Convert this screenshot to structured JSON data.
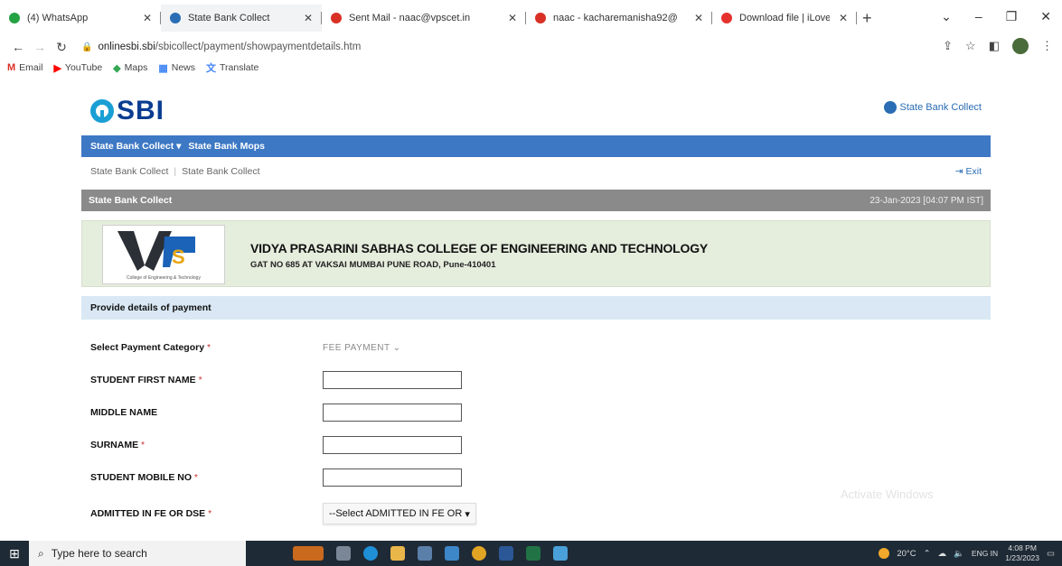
{
  "browser": {
    "tabs": [
      {
        "label": "(4) WhatsApp",
        "favicon": "whatsapp-icon",
        "color": "#25a244"
      },
      {
        "label": "State Bank Collect",
        "favicon": "sbi-icon",
        "color": "#2a6db5"
      },
      {
        "label": "Sent Mail - naac@vpscet.in",
        "favicon": "gmail-icon",
        "color": "#d93025"
      },
      {
        "label": "naac - kacharemanisha92@",
        "favicon": "gmail-icon",
        "color": "#d93025"
      },
      {
        "label": "Download file | iLovePDF",
        "favicon": "ilovepdf-icon",
        "color": "#e5322d"
      }
    ],
    "url_host": "onlinesbi.sbi",
    "url_path": "/sbicollect/payment/showpaymentdetails.htm",
    "bookmarks": [
      {
        "label": "Email",
        "icon": "gmail-icon",
        "color": "#d93025"
      },
      {
        "label": "YouTube",
        "icon": "youtube-icon",
        "color": "#ff0000"
      },
      {
        "label": "Maps",
        "icon": "maps-icon",
        "color": "#34a853"
      },
      {
        "label": "News",
        "icon": "news-icon",
        "color": "#4285f4"
      },
      {
        "label": "Translate",
        "icon": "translate-icon",
        "color": "#4285f4"
      }
    ]
  },
  "sbi": {
    "logo_text": "SBI",
    "collect_link": "State Bank Collect",
    "menu": [
      "State Bank Collect",
      "State Bank Mops"
    ],
    "breadcrumb": [
      "State Bank Collect",
      "State Bank Collect"
    ],
    "exit_label": "Exit",
    "section_title": "State Bank Collect",
    "datetime": "23-Jan-2023 [04:07 PM IST]",
    "college_name": "VIDYA PRASARINI SABHAS COLLEGE OF ENGINEERING AND TECHNOLOGY",
    "college_address": "GAT NO 685 AT VAKSAI MUMBAI PUNE ROAD,  Pune-410401",
    "college_logo_caption": "College of Engineering & Technology",
    "provide_title": "Provide details of payment",
    "form": {
      "category_label": "Select Payment Category",
      "category_value": "FEE PAYMENT",
      "first_name_label": "STUDENT FIRST NAME",
      "middle_name_label": "MIDDLE NAME",
      "surname_label": "SURNAME",
      "mobile_label": "STUDENT MOBILE NO",
      "admitted_label": "ADMITTED IN FE OR DSE",
      "admitted_value": "--Select ADMITTED IN FE OR",
      "required_mark": "*"
    },
    "watermark": "Activate Windows"
  },
  "taskbar": {
    "search_placeholder": "Type here to search",
    "weather": "20°C",
    "lang": "ENG IN",
    "time": "4:08 PM",
    "date": "1/23/2023"
  },
  "colors": {
    "menu_blue": "#3d78c4",
    "section_grey": "#8a8a8a",
    "college_bg": "#e5eddd",
    "provide_bg": "#d9e8f4"
  }
}
